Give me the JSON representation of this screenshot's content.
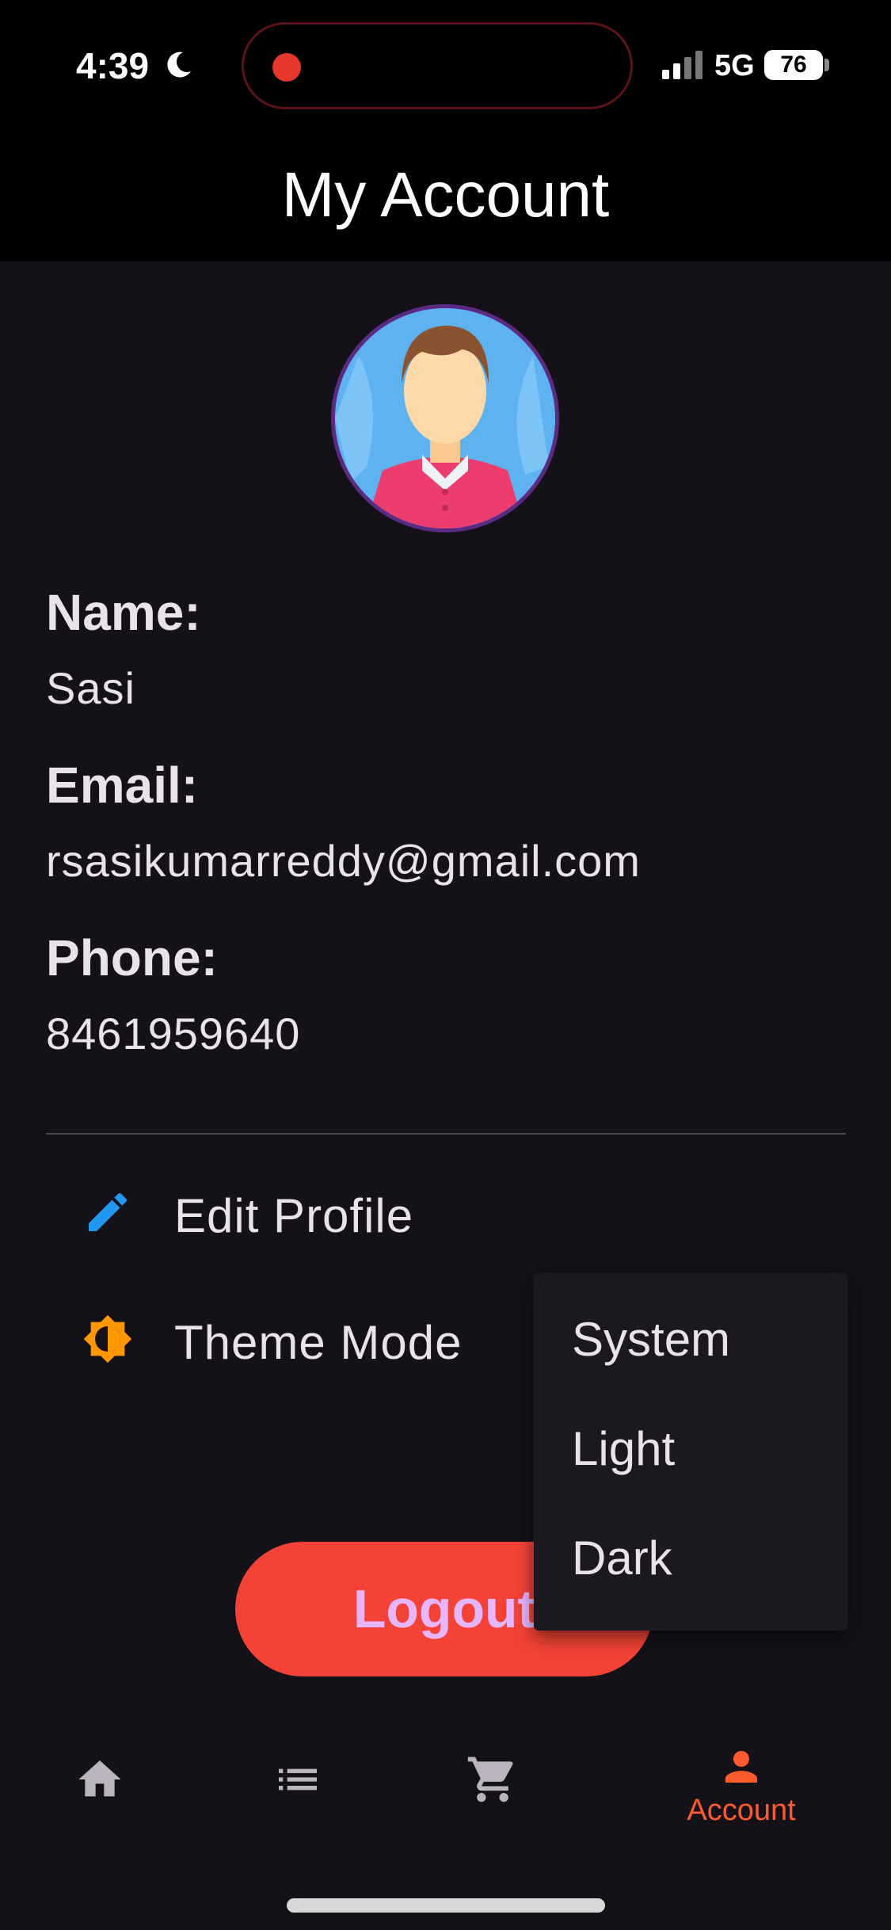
{
  "status_bar": {
    "time": "4:39",
    "network": "5G",
    "battery": "76"
  },
  "header": {
    "title": "My Account"
  },
  "profile": {
    "name_label": "Name:",
    "name": "Sasi",
    "email_label": "Email:",
    "email": "rsasikumarreddy@gmail.com",
    "phone_label": "Phone:",
    "phone": "8461959640"
  },
  "menu": {
    "edit_profile": {
      "label": "Edit Profile",
      "icon": "pencil-icon"
    },
    "theme_mode": {
      "label": "Theme Mode",
      "icon": "brightness-icon"
    }
  },
  "theme_dropdown": {
    "options": [
      "System",
      "Light",
      "Dark"
    ]
  },
  "logout": {
    "label": "Logout"
  },
  "bottom_nav": {
    "items": [
      {
        "icon": "home-icon",
        "label": ""
      },
      {
        "icon": "list-icon",
        "label": ""
      },
      {
        "icon": "cart-icon",
        "label": ""
      },
      {
        "icon": "person-icon",
        "label": "Account"
      }
    ]
  },
  "colors": {
    "accent": "#ff5a2d",
    "logout_bg": "#f44336",
    "logout_text": "#e7b6ff",
    "background": "#141218"
  }
}
